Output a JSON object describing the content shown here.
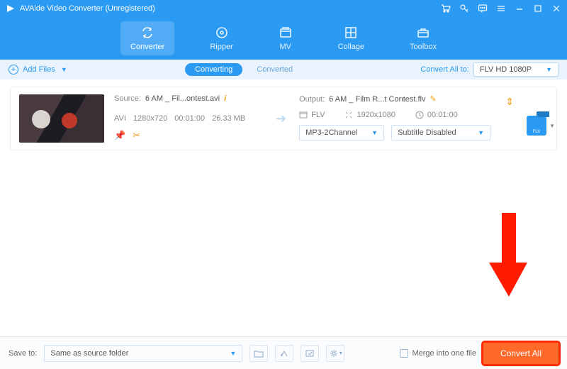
{
  "titlebar": {
    "title": "AVAide Video Converter (Unregistered)"
  },
  "nav": {
    "converter": "Converter",
    "ripper": "Ripper",
    "mv": "MV",
    "collage": "Collage",
    "toolbox": "Toolbox"
  },
  "subbar": {
    "add_files": "Add Files",
    "converting": "Converting",
    "converted": "Converted",
    "convert_all_to": "Convert All to:",
    "format": "FLV HD 1080P"
  },
  "card": {
    "source_label": "Source:",
    "source_name": "6 AM _ Fil...ontest.avi",
    "codec": "AVI",
    "resolution": "1280x720",
    "duration": "00:01:00",
    "size": "26.33 MB",
    "output_label": "Output:",
    "output_name": "6 AM _ Film R...t Contest.flv",
    "out_fmt": "FLV",
    "out_res": "1920x1080",
    "out_dur": "00:01:00",
    "audio_sel": "MP3-2Channel",
    "subtitle_sel": "Subtitle Disabled",
    "badge_text": "FLV"
  },
  "footer": {
    "save_to": "Save to:",
    "save_path": "Same as source folder",
    "merge": "Merge into one file",
    "convert_all": "Convert All"
  }
}
